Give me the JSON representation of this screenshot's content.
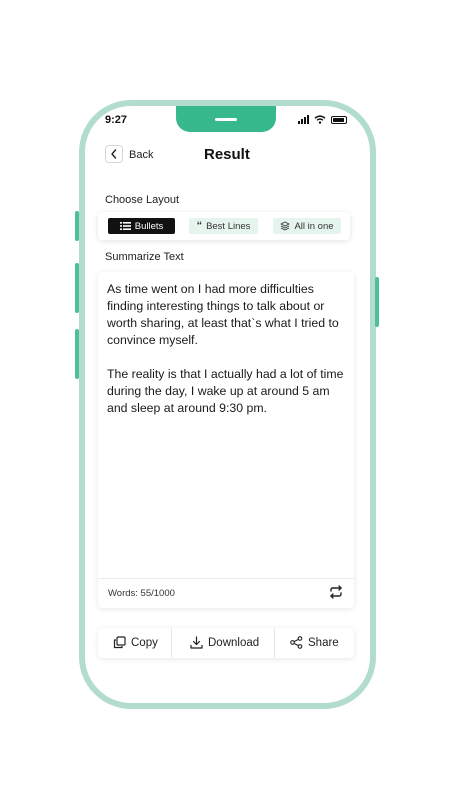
{
  "status_bar": {
    "time": "9:27"
  },
  "header": {
    "back_label": "Back",
    "title": "Result"
  },
  "layout": {
    "heading": "Choose Layout",
    "options": [
      {
        "label": "Bullets",
        "icon": "list-icon",
        "selected": true
      },
      {
        "label": "Best Lines",
        "icon": "quote-icon",
        "selected": false
      },
      {
        "label": "All in one",
        "icon": "layers-icon",
        "selected": false
      }
    ]
  },
  "summary": {
    "heading": "Summarize Text",
    "paragraphs": [
      "As time went on I had more difficulties finding interesting things to talk about or worth sharing, at least that`s what I tried to convince myself.",
      "The reality is that I actually had a lot of time during the day, I wake up at around 5 am and sleep at around 9:30 pm."
    ],
    "word_count": "Words: 55/1000"
  },
  "actions": [
    {
      "label": "Copy",
      "icon": "copy-icon"
    },
    {
      "label": "Download",
      "icon": "download-icon"
    },
    {
      "label": "Share",
      "icon": "share-icon"
    }
  ],
  "colors": {
    "accent": "#38b88d",
    "frame": "#b2dccb",
    "chip_idle": "#e6f4ee"
  }
}
